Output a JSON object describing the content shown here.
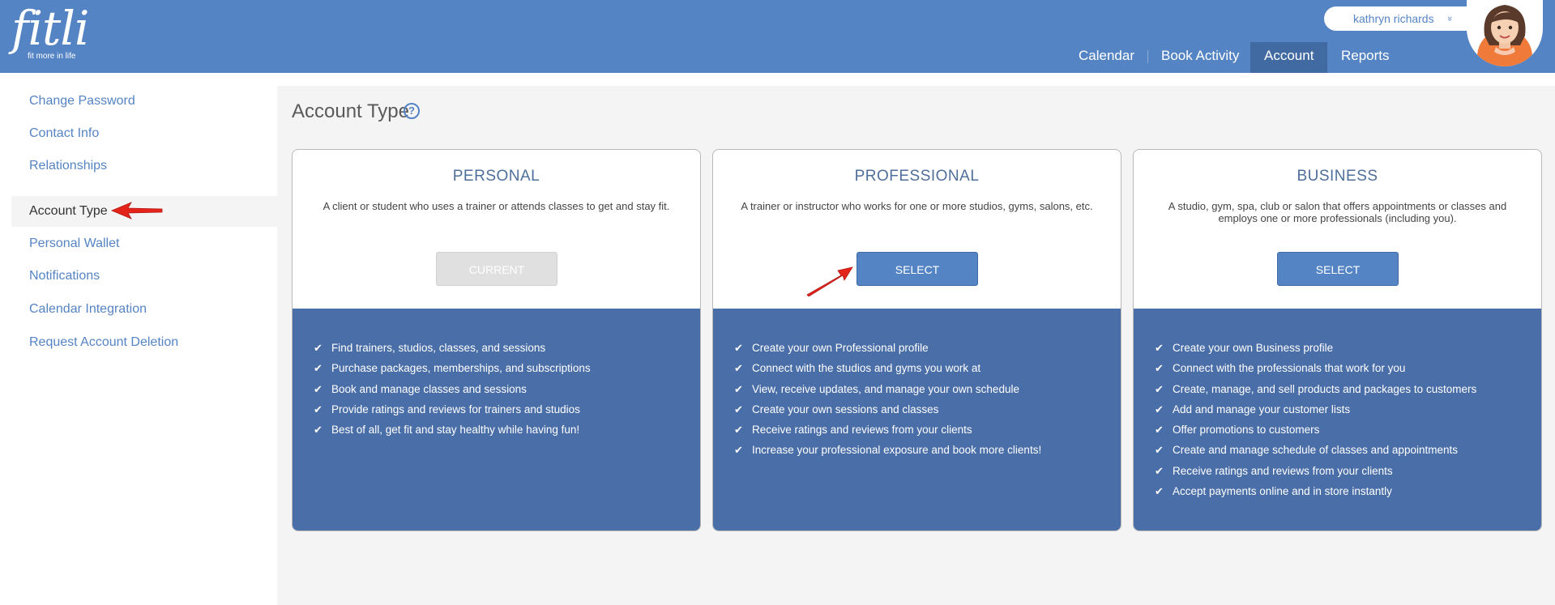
{
  "app": {
    "logo_word": "fitli",
    "logo_tagline": "fit more in life"
  },
  "header": {
    "user_name": "kathryn richards",
    "user_chevron": "»",
    "nav": [
      {
        "label": "Calendar"
      },
      {
        "label": "Book Activity"
      },
      {
        "label": "Account",
        "active": true
      },
      {
        "label": "Reports"
      }
    ]
  },
  "sidebar": {
    "items": [
      {
        "label": "Change Password"
      },
      {
        "label": "Contact Info"
      },
      {
        "label": "Relationships"
      },
      {
        "label": "Account Type",
        "active": true
      },
      {
        "label": "Personal Wallet"
      },
      {
        "label": "Notifications"
      },
      {
        "label": "Calendar Integration"
      },
      {
        "label": "Request Account Deletion"
      }
    ]
  },
  "main": {
    "title": "Account Type",
    "help_glyph": "?",
    "cards": [
      {
        "title": "PERSONAL",
        "description": "A client or student who uses a trainer or attends classes to get and stay fit.",
        "button": "CURRENT",
        "button_state": "current",
        "features": [
          "Find trainers, studios, classes, and sessions",
          "Purchase packages, memberships, and subscriptions",
          "Book and manage classes and sessions",
          "Provide ratings and reviews for trainers and studios",
          "Best of all, get fit and stay healthy while having fun!"
        ]
      },
      {
        "title": "PROFESSIONAL",
        "description": "A trainer or instructor who works for one or more studios, gyms, salons, etc.",
        "button": "SELECT",
        "button_state": "select",
        "features": [
          "Create your own Professional profile",
          "Connect with the studios and gyms you work at",
          "View, receive updates, and manage your own schedule",
          "Create your own sessions and classes",
          "Receive ratings and reviews from your clients",
          "Increase your professional exposure and book more clients!"
        ]
      },
      {
        "title": "BUSINESS",
        "description": "A studio, gym, spa, club or salon that offers appointments or classes and employs one or more professionals (including you).",
        "button": "SELECT",
        "button_state": "select",
        "features": [
          "Create your own Business profile",
          "Connect with the professionals that work for you",
          "Create, manage, and sell products and packages to customers",
          "Add and manage your customer lists",
          "Offer promotions to customers",
          "Create and manage schedule of classes and appointments",
          "Receive ratings and reviews from your clients",
          "Accept payments online and in store instantly"
        ]
      }
    ]
  },
  "colors": {
    "header_bg": "#5584c4",
    "nav_active_bg": "#416aa3",
    "link_blue": "#5584c4",
    "card_list_bg": "#4a6ea7",
    "annotation_arrow": "#e4231b"
  },
  "icons": {
    "check": "✔",
    "help": "help-circle-icon",
    "annotation": "red-arrow-icon"
  }
}
